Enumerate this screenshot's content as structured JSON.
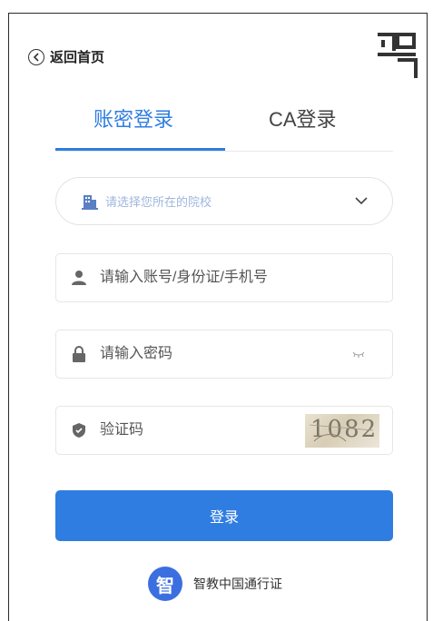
{
  "back": {
    "label": "返回首页"
  },
  "tabs": [
    {
      "label": "账密登录",
      "active": true
    },
    {
      "label": "CA登录",
      "active": false
    }
  ],
  "school_select": {
    "placeholder": "请选择您所在的院校"
  },
  "account": {
    "placeholder": "请输入账号/身份证/手机号"
  },
  "password": {
    "placeholder": "请输入密码"
  },
  "captcha": {
    "placeholder": "验证码",
    "image_text": "1082"
  },
  "login_button": {
    "label": "登录"
  },
  "passport": {
    "label": "智教中国通行证",
    "logo_char": "智"
  },
  "colors": {
    "accent": "#2f7de1",
    "border": "#e6e6e6",
    "text": "#333333"
  }
}
